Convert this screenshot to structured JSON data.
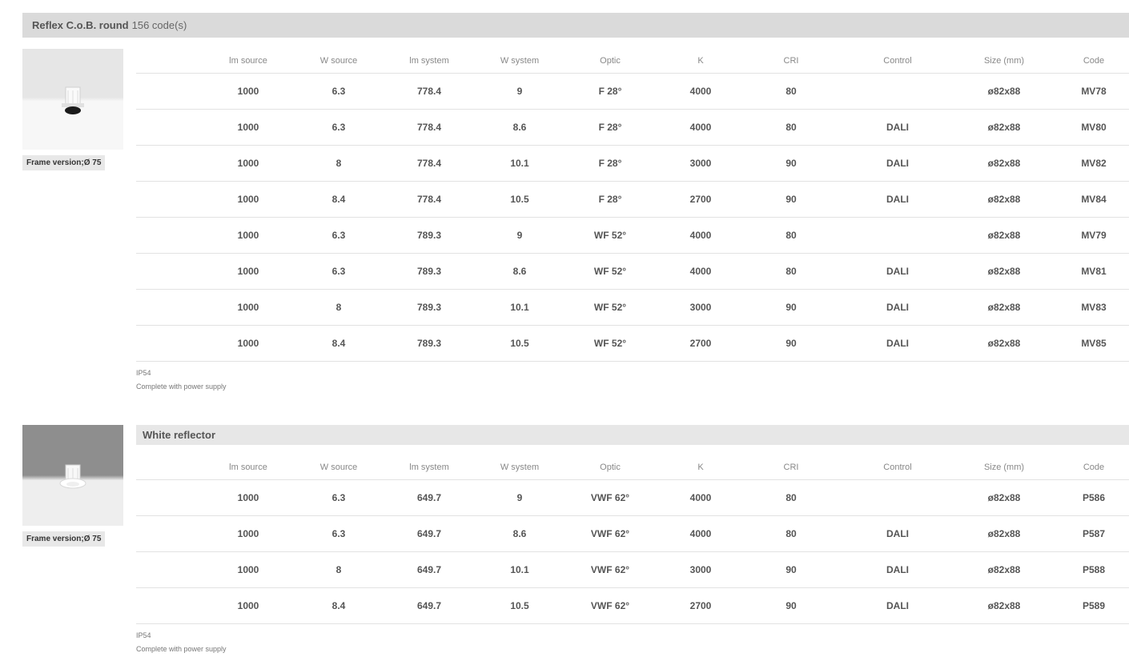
{
  "section": {
    "title": "Reflex C.o.B. round",
    "count_label": "156 code(s)"
  },
  "columns": [
    "lm source",
    "W source",
    "lm system",
    "W system",
    "Optic",
    "K",
    "CRI",
    "Control",
    "Size (mm)",
    "Code"
  ],
  "group1": {
    "badge": "Frame version;Ø 75",
    "rows": [
      [
        "1000",
        "6.3",
        "778.4",
        "9",
        "F 28°",
        "4000",
        "80",
        "",
        "ø82x88",
        "MV78"
      ],
      [
        "1000",
        "6.3",
        "778.4",
        "8.6",
        "F 28°",
        "4000",
        "80",
        "DALI",
        "ø82x88",
        "MV80"
      ],
      [
        "1000",
        "8",
        "778.4",
        "10.1",
        "F 28°",
        "3000",
        "90",
        "DALI",
        "ø82x88",
        "MV82"
      ],
      [
        "1000",
        "8.4",
        "778.4",
        "10.5",
        "F 28°",
        "2700",
        "90",
        "DALI",
        "ø82x88",
        "MV84"
      ],
      [
        "1000",
        "6.3",
        "789.3",
        "9",
        "WF 52°",
        "4000",
        "80",
        "",
        "ø82x88",
        "MV79"
      ],
      [
        "1000",
        "6.3",
        "789.3",
        "8.6",
        "WF 52°",
        "4000",
        "80",
        "DALI",
        "ø82x88",
        "MV81"
      ],
      [
        "1000",
        "8",
        "789.3",
        "10.1",
        "WF 52°",
        "3000",
        "90",
        "DALI",
        "ø82x88",
        "MV83"
      ],
      [
        "1000",
        "8.4",
        "789.3",
        "10.5",
        "WF 52°",
        "2700",
        "90",
        "DALI",
        "ø82x88",
        "MV85"
      ]
    ],
    "note_ip": "IP54",
    "note_power": "Complete with power supply"
  },
  "group2": {
    "title": "White reflector",
    "badge": "Frame version;Ø 75",
    "rows": [
      [
        "1000",
        "6.3",
        "649.7",
        "9",
        "VWF 62°",
        "4000",
        "80",
        "",
        "ø82x88",
        "P586"
      ],
      [
        "1000",
        "6.3",
        "649.7",
        "8.6",
        "VWF 62°",
        "4000",
        "80",
        "DALI",
        "ø82x88",
        "P587"
      ],
      [
        "1000",
        "8",
        "649.7",
        "10.1",
        "VWF 62°",
        "3000",
        "90",
        "DALI",
        "ø82x88",
        "P588"
      ],
      [
        "1000",
        "8.4",
        "649.7",
        "10.5",
        "VWF 62°",
        "2700",
        "90",
        "DALI",
        "ø82x88",
        "P589"
      ]
    ],
    "note_ip": "IP54",
    "note_power": "Complete with power supply"
  }
}
